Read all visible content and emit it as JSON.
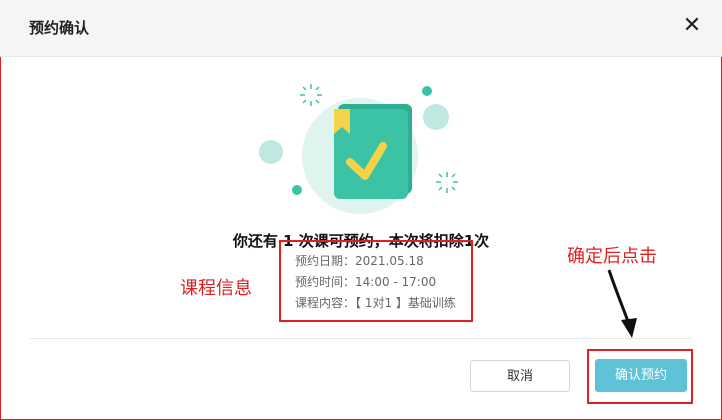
{
  "dialog": {
    "title": "预约确认",
    "close_icon": "close-icon"
  },
  "illustration": {
    "icon": "book-checkmark-icon"
  },
  "main_message": "你还有 1 次课可预约，本次将扣除1次",
  "details": {
    "date": "预约日期：2021.05.18",
    "time": "预约时间：14:00 - 17:00",
    "content": "课程内容：【 1对1 】基础训练"
  },
  "annotations": {
    "course_info": "课程信息",
    "click_after_confirm": "确定后点击"
  },
  "footer": {
    "cancel_label": "取消",
    "confirm_label": "确认预约"
  },
  "colors": {
    "primary_button": "#5fc3d8",
    "book_green": "#3cc3a6",
    "annotation_red": "#e02020"
  }
}
